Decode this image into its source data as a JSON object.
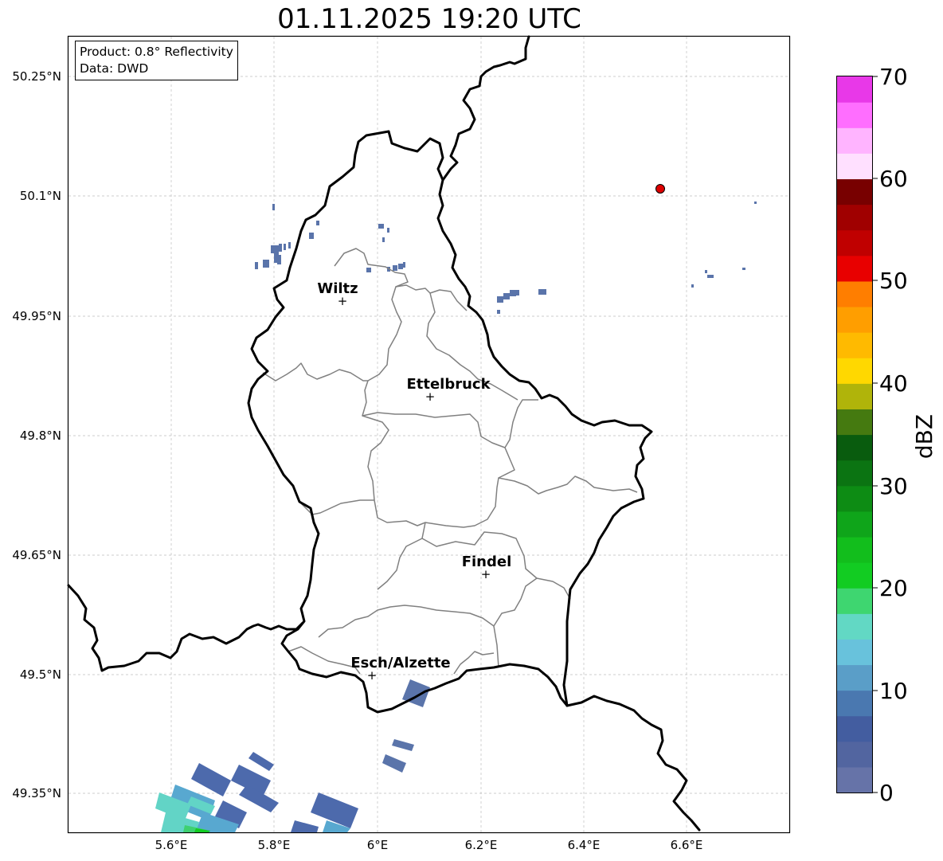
{
  "header": {
    "title": "01.11.2025 19:20 UTC"
  },
  "info_box": {
    "product": "Product: 0.8° Reflectivity",
    "source": "Data: DWD"
  },
  "axes": {
    "lon_ticks": [
      "5.6°E",
      "5.8°E",
      "6°E",
      "6.2°E",
      "6.4°E",
      "6.6°E"
    ],
    "lat_ticks": [
      "50.25°N",
      "50.1°N",
      "49.95°N",
      "49.8°N",
      "49.65°N",
      "49.5°N",
      "49.35°N"
    ]
  },
  "cities": [
    {
      "name": "Wiltz"
    },
    {
      "name": "Ettelbruck"
    },
    {
      "name": "Findel"
    },
    {
      "name": "Esch/Alzette"
    }
  ],
  "colorbar": {
    "label": "dBZ",
    "ticks": [
      "0",
      "10",
      "20",
      "30",
      "40",
      "50",
      "60",
      "70"
    ],
    "colors": [
      "#6673a8",
      "#5265a0",
      "#435da0",
      "#4a78b0",
      "#5a9ec8",
      "#68c2dc",
      "#62d8c4",
      "#3ed670",
      "#12cc22",
      "#12be1c",
      "#0fa51a",
      "#0d8c14",
      "#0b7412",
      "#095c0e",
      "#457a10",
      "#b0b40a",
      "#ffd800",
      "#ffba00",
      "#ff9e00",
      "#ff7e00",
      "#e80000",
      "#c00000",
      "#a00000",
      "#780000",
      "#ffe0ff",
      "#ffb4ff",
      "#ff6eff",
      "#e838e8"
    ]
  },
  "marker_color": "#dd0000"
}
